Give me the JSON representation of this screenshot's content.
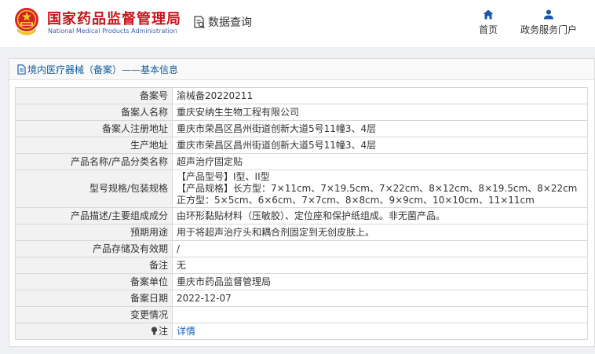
{
  "header": {
    "brand_cn": "国家药品监督管理局",
    "brand_en": "National Medical Products Administration",
    "query_label": "数据查询",
    "nav": {
      "home": "首页",
      "portal": "政务服务门户"
    }
  },
  "breadcrumb": "境内医疗器械（备案）——基本信息",
  "record": {
    "filing_no": {
      "label": "备案号",
      "value": "渝械备20220211"
    },
    "filer_name": {
      "label": "备案人名称",
      "value": "重庆安纳生生物工程有限公司"
    },
    "filer_address": {
      "label": "备案人注册地址",
      "value": "重庆市荣昌区昌州街道创新大道5号11幢3、4层"
    },
    "production_address": {
      "label": "生产地址",
      "value": "重庆市荣昌区昌州街道创新大道5号11幢3、4层"
    },
    "product_name": {
      "label": "产品名称/产品分类名称",
      "value": "超声治疗固定贴"
    },
    "model_spec": {
      "label": "型号规格/包装规格",
      "line1": "【产品型号】I型、II型",
      "line2": "【产品规格】长方型：7×11cm、7×19.5cm、7×22cm、8×12cm、8×19.5cm、8×22cm",
      "line3": "正方型：5×5cm、6×6cm、7×7cm、8×8cm、9×9cm、10×10cm、11×11cm"
    },
    "description": {
      "label": "产品描述/主要组成成分",
      "value": "由环形黏贴材料（压敏胶）、定位座和保护纸组成。非无菌产品。"
    },
    "intended_use": {
      "label": "预期用途",
      "value": "用于将超声治疗头和耦合剂固定到无创皮肤上。"
    },
    "storage": {
      "label": "产品存储及有效期",
      "value": "/"
    },
    "remark": {
      "label": "备注",
      "value": "无"
    },
    "filing_unit": {
      "label": "备案单位",
      "value": "重庆市药品监督管理局"
    },
    "filing_date": {
      "label": "备案日期",
      "value": "2022-12-07"
    },
    "change_info": {
      "label": "变更情况",
      "value": ""
    },
    "note": {
      "label": "注",
      "value": "详情"
    }
  },
  "colors": {
    "brand_red": "#c4161c",
    "nav_blue": "#1a57a8",
    "link_blue": "#1a64b8"
  }
}
